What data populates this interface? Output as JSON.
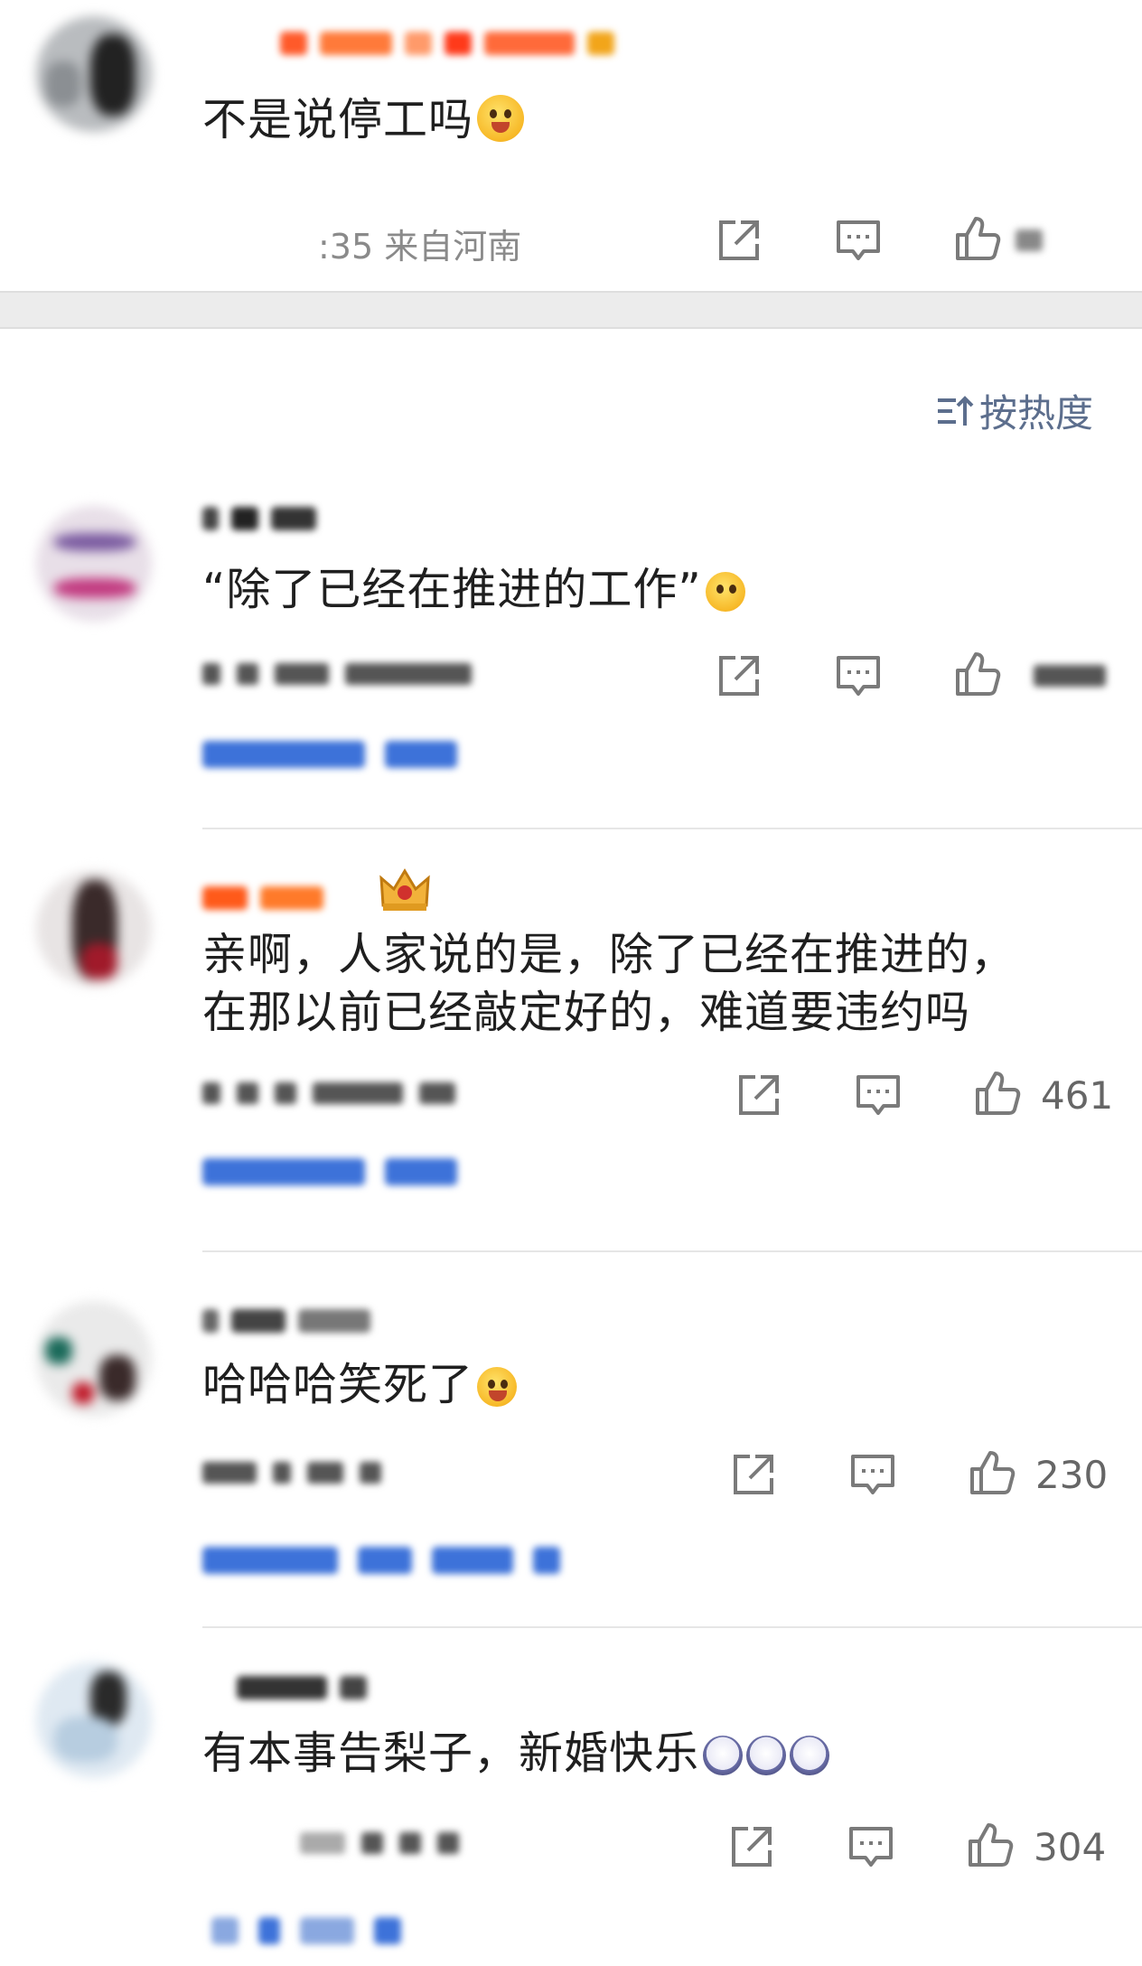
{
  "top_comment": {
    "text": "不是说停工吗",
    "emoji": "laugh-cry-emoji",
    "time_location": ":35 来自河南"
  },
  "sort": {
    "label": "按热度",
    "icon": "sort-icon"
  },
  "comments": [
    {
      "text": "“除了已经在推进的工作”",
      "emoji": "wave-emoji",
      "likes": ""
    },
    {
      "text_line1": "亲啊，人家说的是，除了已经在推进的，",
      "text_line2": "在那以前已经敲定好的，难道要违约吗",
      "badge": "crown-badge-icon",
      "likes": "461"
    },
    {
      "text": "哈哈哈笑死了",
      "emoji": "laughing-emoji",
      "likes": "230"
    },
    {
      "text": "有本事告梨子，新婚快乐",
      "emoji": "panda-emoji",
      "likes": "304"
    }
  ],
  "colors": {
    "accent_orange": "#ff7a1a",
    "link_blue": "#3d72d9",
    "meta_gray": "#8a8a8a",
    "sort_blue_gray": "#5c6e8d"
  }
}
